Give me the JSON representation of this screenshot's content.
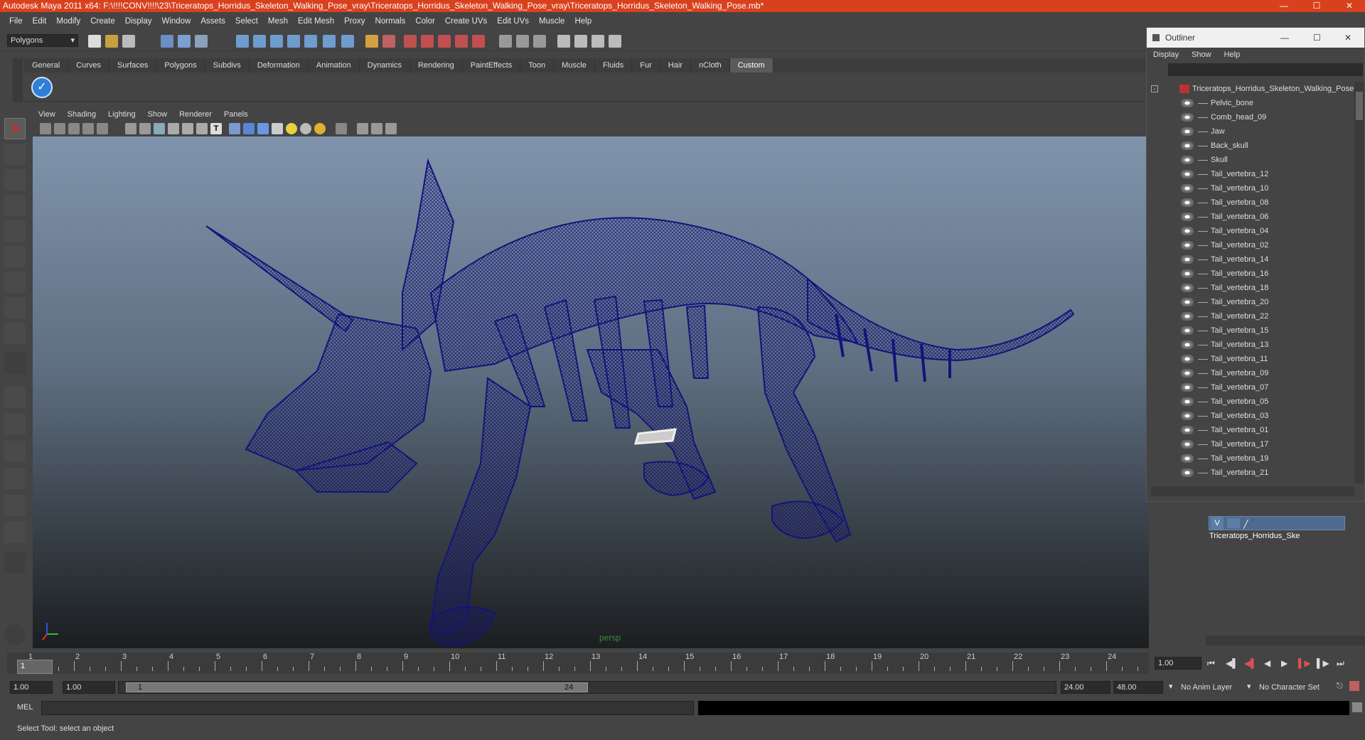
{
  "window": {
    "title": "Autodesk Maya 2011 x64: F:\\!!!!CONV!!!!\\23\\Triceratops_Horridus_Skeleton_Walking_Pose_vray\\Triceratops_Horridus_Skeleton_Walking_Pose_vray\\Triceratops_Horridus_Skeleton_Walking_Pose.mb*",
    "accent": "#d9411e"
  },
  "menubar": [
    "File",
    "Edit",
    "Modify",
    "Create",
    "Display",
    "Window",
    "Assets",
    "Select",
    "Mesh",
    "Edit Mesh",
    "Proxy",
    "Normals",
    "Color",
    "Create UVs",
    "Edit UVs",
    "Muscle",
    "Help"
  ],
  "statusline": {
    "mode": "Polygons"
  },
  "shelf": {
    "tabs": [
      "General",
      "Curves",
      "Surfaces",
      "Polygons",
      "Subdivs",
      "Deformation",
      "Animation",
      "Dynamics",
      "Rendering",
      "PaintEffects",
      "Toon",
      "Muscle",
      "Fluids",
      "Fur",
      "Hair",
      "nCloth",
      "Custom"
    ],
    "active_tab": "Custom"
  },
  "panel": {
    "menu": [
      "View",
      "Shading",
      "Lighting",
      "Show",
      "Renderer",
      "Panels"
    ],
    "camera_label": "persp",
    "wireframe_color": "#14147a"
  },
  "timeline": {
    "ticks": [
      "1",
      "2",
      "3",
      "4",
      "5",
      "6",
      "7",
      "8",
      "9",
      "10",
      "11",
      "12",
      "13",
      "14",
      "15",
      "16",
      "17",
      "18",
      "19",
      "20",
      "21",
      "22",
      "23",
      "24"
    ],
    "current_frame": "1",
    "current_time_field": "1.00"
  },
  "range": {
    "start": "1.00",
    "playback_start": "1.00",
    "slider_start_label": "1",
    "slider_end_label": "24",
    "playback_end": "24.00",
    "end": "48.00",
    "anim_layer": "No Anim Layer",
    "character_set": "No Character Set"
  },
  "command": {
    "lang": "MEL"
  },
  "helpline": {
    "text": "Select Tool: select an object"
  },
  "outliner": {
    "title": "Outliner",
    "menu": [
      "Display",
      "Show",
      "Help"
    ],
    "root": "Triceratops_Horridus_Skeleton_Walking_Pose",
    "items": [
      "Pelvic_bone",
      "Comb_head_09",
      "Jaw",
      "Back_skull",
      "Skull",
      "Tail_vertebra_12",
      "Tail_vertebra_10",
      "Tail_vertebra_08",
      "Tail_vertebra_06",
      "Tail_vertebra_04",
      "Tail_vertebra_02",
      "Tail_vertebra_14",
      "Tail_vertebra_16",
      "Tail_vertebra_18",
      "Tail_vertebra_20",
      "Tail_vertebra_22",
      "Tail_vertebra_15",
      "Tail_vertebra_13",
      "Tail_vertebra_11",
      "Tail_vertebra_09",
      "Tail_vertebra_07",
      "Tail_vertebra_05",
      "Tail_vertebra_03",
      "Tail_vertebra_01",
      "Tail_vertebra_17",
      "Tail_vertebra_19",
      "Tail_vertebra_21"
    ]
  },
  "layers": {
    "row": {
      "visible": "V",
      "name": "Triceratops_Horridus_Ske"
    }
  }
}
